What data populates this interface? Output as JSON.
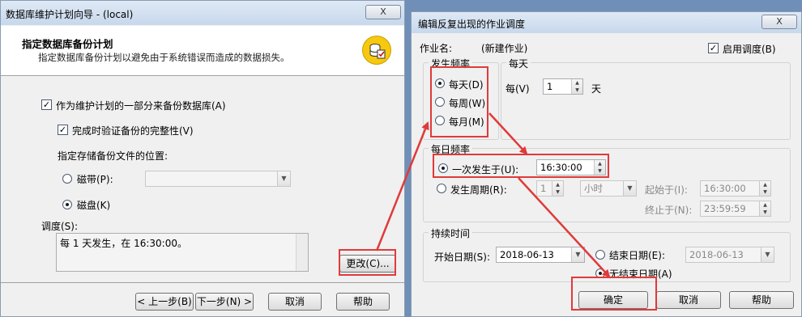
{
  "wizard": {
    "title": "数据库维护计划向导 - (local)",
    "close_label": "X",
    "header_title": "指定数据库备份计划",
    "header_subtitle": "指定数据库备份计划以避免由于系统错误而造成的数据损失。",
    "icon": "database-backup-icon",
    "backup_as_part_label": "作为维护计划的一部分来备份数据库(A)",
    "backup_as_part_checked": true,
    "verify_label": "完成时验证备份的完整性(V)",
    "verify_checked": true,
    "location_label": "指定存储备份文件的位置:",
    "tape_label": "磁带(P):",
    "tape_value": "",
    "disk_label": "磁盘(K)",
    "selected_location": "磁盘(K)",
    "schedule_label": "调度(S):",
    "schedule_text": "每 1 天发生，在 16:30:00。",
    "change_button": "更改(C)...",
    "back_button": "< 上一步(B)",
    "next_button": "下一步(N) >",
    "cancel_button": "取消",
    "help_button": "帮助"
  },
  "schedule_dialog": {
    "title": "编辑反复出现的作业调度",
    "close_label": "X",
    "job_name_label": "作业名:",
    "job_name_value": "(新建作业)",
    "enable_label": "启用调度(B)",
    "enable_checked": true,
    "occurs_group": "发生频率",
    "daily_label": "每天(D)",
    "weekly_label": "每周(W)",
    "monthly_label": "每月(M)",
    "occurs_selected": "每天(D)",
    "daily_group": "每天",
    "every_label": "每(V)",
    "every_value": "1",
    "days_unit": "天",
    "freq_group": "每日频率",
    "once_at_label": "一次发生于(U):",
    "once_at_value": "16:30:00",
    "every_period_label": "发生周期(R):",
    "period_value": "1",
    "period_unit": "小时",
    "start_at_label": "起始于(I):",
    "start_at_value": "16:30:00",
    "end_at_label": "终止于(N):",
    "end_at_value": "23:59:59",
    "freq_selected": "一次发生于(U):",
    "duration_group": "持续时间",
    "start_date_label": "开始日期(S):",
    "start_date_value": "2018-06-13",
    "end_date_label": "结束日期(E):",
    "end_date_value": "2018-06-13",
    "no_end_label": "无结束日期(A)",
    "duration_selected": "无结束日期(A)",
    "ok_button": "确定",
    "cancel_button": "取消",
    "help_button": "帮助"
  },
  "colors": {
    "highlight": "#e03a3a",
    "background": "#6f8fb8",
    "window": "#f0f0f0"
  }
}
